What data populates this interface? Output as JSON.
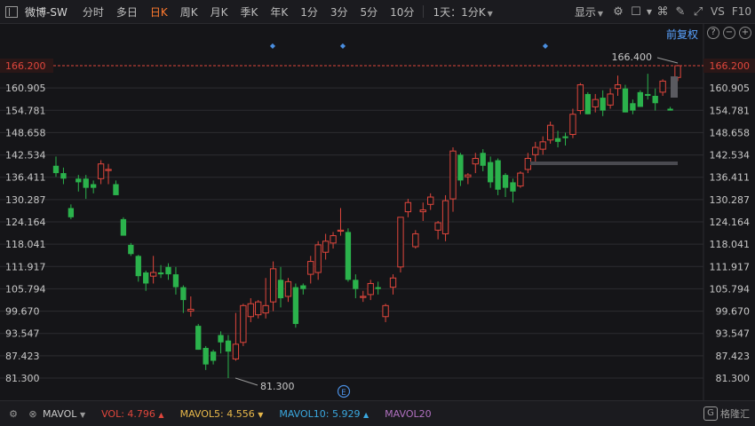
{
  "toolbar": {
    "stock_name": "微博-SW",
    "periods": [
      "分时",
      "多日",
      "日K",
      "周K",
      "月K",
      "季K",
      "年K",
      "1分",
      "3分",
      "5分",
      "10分"
    ],
    "active_period": "日K",
    "multi_day_select": "1天：1分K",
    "display_label": "显示",
    "vs_label": "VS",
    "f10_label": "F10"
  },
  "adjust": {
    "label": "前复权"
  },
  "colors": {
    "up": "#e0463c",
    "down": "#2bb24c",
    "grid": "#2c2c30",
    "axis_text": "#c8c8c8"
  },
  "chart_data": {
    "type": "candlestick",
    "y_ticks": [
      "166.200",
      "160.905",
      "154.781",
      "148.658",
      "142.534",
      "136.411",
      "130.287",
      "124.164",
      "118.041",
      "111.917",
      "105.794",
      "99.670",
      "93.547",
      "87.423",
      "81.300"
    ],
    "ylim": [
      81.3,
      166.2
    ],
    "current_price_label": "166.200",
    "high_annotation": "166.400",
    "low_annotation": "81.300",
    "event_marker": "E",
    "candles": [
      [
        139.0,
        141.5,
        136.0,
        137.0
      ],
      [
        137.0,
        138.5,
        134.0,
        135.5
      ],
      [
        127.5,
        128.5,
        124.5,
        125.0
      ],
      [
        135.5,
        136.5,
        132.0,
        134.5
      ],
      [
        135.5,
        136.5,
        130.0,
        133.0
      ],
      [
        134.0,
        135.0,
        131.5,
        133.0
      ],
      [
        135.5,
        140.5,
        134.0,
        139.5
      ],
      [
        138.0,
        139.5,
        134.0,
        138.0
      ],
      [
        134.0,
        135.0,
        131.0,
        131.0
      ],
      [
        124.5,
        125.0,
        120.0,
        120.0
      ],
      [
        117.5,
        118.0,
        114.5,
        115.0
      ],
      [
        114.5,
        114.8,
        107.5,
        109.0
      ],
      [
        110.0,
        110.5,
        105.0,
        107.0
      ],
      [
        109.0,
        114.5,
        107.0,
        110.0
      ],
      [
        110.0,
        112.0,
        108.5,
        109.5
      ],
      [
        111.5,
        112.5,
        108.0,
        109.5
      ],
      [
        109.5,
        111.5,
        104.0,
        106.0
      ],
      [
        106.0,
        106.5,
        99.0,
        102.5
      ],
      [
        99.5,
        103.5,
        98.0,
        100.0
      ],
      [
        95.5,
        96.0,
        89.0,
        89.0
      ],
      [
        89.5,
        90.0,
        83.5,
        85.0
      ],
      [
        88.5,
        89.0,
        85.0,
        86.0
      ],
      [
        93.0,
        94.0,
        88.0,
        91.0
      ],
      [
        91.5,
        93.0,
        81.3,
        88.5
      ],
      [
        86.5,
        99.0,
        86.0,
        90.5
      ],
      [
        91.0,
        101.5,
        90.0,
        101.0
      ],
      [
        98.0,
        103.0,
        96.5,
        101.5
      ],
      [
        98.5,
        102.5,
        97.5,
        102.0
      ],
      [
        99.0,
        108.5,
        97.5,
        101.0
      ],
      [
        102.0,
        113.0,
        99.5,
        111.0
      ],
      [
        108.0,
        111.5,
        100.5,
        103.0
      ],
      [
        103.5,
        108.5,
        102.0,
        107.5
      ],
      [
        106.0,
        107.0,
        95.0,
        96.0
      ],
      [
        106.5,
        107.0,
        104.0,
        105.5
      ],
      [
        109.5,
        114.5,
        107.0,
        113.0
      ],
      [
        110.0,
        118.5,
        108.0,
        117.5
      ],
      [
        115.5,
        120.5,
        113.5,
        118.5
      ],
      [
        118.0,
        121.0,
        116.5,
        120.0
      ],
      [
        121.5,
        127.5,
        120.0,
        121.5
      ],
      [
        121.0,
        122.0,
        107.5,
        108.0
      ],
      [
        108.0,
        109.5,
        103.0,
        105.5
      ],
      [
        103.5,
        105.0,
        102.0,
        103.5
      ],
      [
        104.0,
        108.0,
        102.5,
        107.0
      ],
      [
        106.0,
        107.5,
        104.0,
        105.5
      ],
      [
        98.0,
        101.5,
        96.5,
        101.0
      ],
      [
        106.0,
        109.5,
        104.0,
        108.5
      ],
      [
        111.5,
        125.0,
        110.0,
        125.0
      ],
      [
        126.5,
        130.0,
        125.0,
        129.0
      ],
      [
        117.0,
        121.5,
        116.5,
        120.5
      ],
      [
        126.5,
        129.0,
        124.0,
        127.0
      ],
      [
        128.5,
        131.5,
        127.0,
        130.5
      ],
      [
        121.5,
        124.0,
        119.0,
        123.5
      ],
      [
        120.5,
        131.0,
        118.5,
        129.5
      ],
      [
        130.0,
        144.0,
        126.5,
        143.0
      ],
      [
        142.0,
        142.5,
        133.5,
        135.0
      ],
      [
        136.0,
        137.0,
        134.0,
        136.5
      ],
      [
        139.5,
        142.5,
        137.0,
        141.0
      ],
      [
        142.5,
        143.5,
        137.5,
        139.0
      ],
      [
        140.0,
        141.5,
        133.0,
        134.5
      ],
      [
        140.5,
        141.0,
        131.0,
        132.5
      ],
      [
        136.5,
        137.0,
        130.5,
        133.0
      ],
      [
        134.5,
        135.5,
        129.0,
        132.0
      ],
      [
        133.5,
        137.5,
        133.0,
        137.0
      ],
      [
        138.0,
        142.5,
        137.0,
        141.0
      ],
      [
        142.0,
        145.5,
        140.0,
        144.0
      ],
      [
        143.5,
        147.0,
        142.0,
        145.5
      ],
      [
        146.0,
        151.0,
        145.0,
        150.0
      ],
      [
        146.5,
        148.5,
        144.0,
        145.5
      ],
      [
        147.0,
        148.0,
        144.5,
        146.5
      ],
      [
        147.5,
        154.5,
        146.5,
        153.0
      ],
      [
        154.0,
        161.5,
        153.0,
        161.0
      ],
      [
        158.5,
        159.0,
        153.0,
        153.0
      ],
      [
        155.0,
        158.5,
        153.5,
        157.0
      ],
      [
        157.5,
        159.5,
        152.5,
        154.0
      ],
      [
        155.5,
        160.0,
        154.5,
        158.5
      ],
      [
        160.0,
        163.5,
        158.0,
        161.0
      ],
      [
        160.0,
        161.0,
        153.5,
        153.5
      ],
      [
        156.0,
        157.0,
        153.0,
        154.0
      ],
      [
        159.0,
        159.5,
        155.0,
        155.0
      ],
      [
        158.5,
        164.0,
        157.0,
        158.0
      ],
      [
        158.0,
        160.0,
        154.0,
        156.0
      ],
      [
        159.0,
        162.5,
        158.0,
        162.0
      ],
      [
        154.5,
        155.0,
        154.0,
        154.0
      ],
      [
        163.0,
        166.4,
        162.0,
        166.2
      ]
    ]
  },
  "volume_bar": {
    "title": "MAVOL",
    "items": [
      {
        "label": "VOL:",
        "value": "4.796",
        "dir": "▲",
        "color": "#e0463c"
      },
      {
        "label": "MAVOL5:",
        "value": "4.556",
        "dir": "▼",
        "color": "#e8b84a"
      },
      {
        "label": "MAVOL10:",
        "value": "5.929",
        "dir": "▲",
        "color": "#3aa8e0"
      },
      {
        "label": "MAVOL20",
        "value": "",
        "dir": "",
        "color": "#b070c0"
      }
    ]
  },
  "watermark": {
    "mark": "G",
    "text": "格隆汇"
  }
}
